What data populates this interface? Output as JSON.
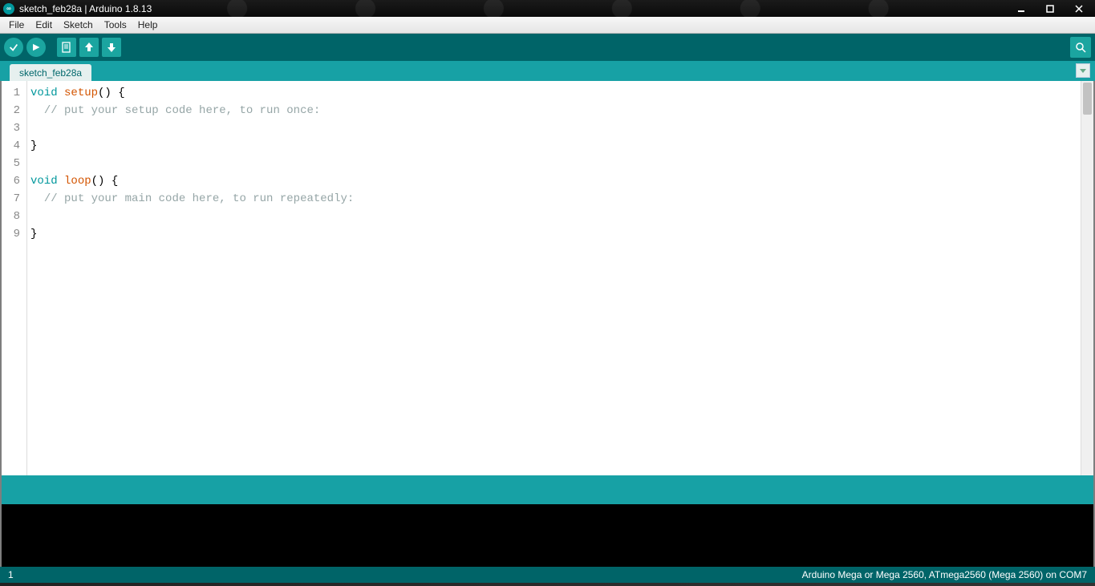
{
  "window": {
    "title": "sketch_feb28a | Arduino 1.8.13",
    "icon_label": "∞"
  },
  "menu": {
    "items": [
      "File",
      "Edit",
      "Sketch",
      "Tools",
      "Help"
    ]
  },
  "tabs": {
    "active": "sketch_feb28a"
  },
  "editor": {
    "lines": [
      {
        "n": "1",
        "tokens": [
          [
            "kw",
            "void"
          ],
          [
            "sp",
            " "
          ],
          [
            "fn",
            "setup"
          ],
          [
            "tx",
            "() {"
          ]
        ]
      },
      {
        "n": "2",
        "tokens": [
          [
            "tx",
            "  "
          ],
          [
            "cm",
            "// put your setup code here, to run once:"
          ]
        ]
      },
      {
        "n": "3",
        "tokens": []
      },
      {
        "n": "4",
        "tokens": [
          [
            "tx",
            "}"
          ]
        ]
      },
      {
        "n": "5",
        "tokens": []
      },
      {
        "n": "6",
        "tokens": [
          [
            "kw",
            "void"
          ],
          [
            "sp",
            " "
          ],
          [
            "fn",
            "loop"
          ],
          [
            "tx",
            "() {"
          ]
        ]
      },
      {
        "n": "7",
        "tokens": [
          [
            "tx",
            "  "
          ],
          [
            "cm",
            "// put your main code here, to run repeatedly:"
          ]
        ]
      },
      {
        "n": "8",
        "tokens": []
      },
      {
        "n": "9",
        "tokens": [
          [
            "tx",
            "}"
          ]
        ]
      }
    ]
  },
  "status": {
    "line_col": "1",
    "board": "Arduino Mega or Mega 2560, ATmega2560 (Mega 2560) on COM7"
  }
}
